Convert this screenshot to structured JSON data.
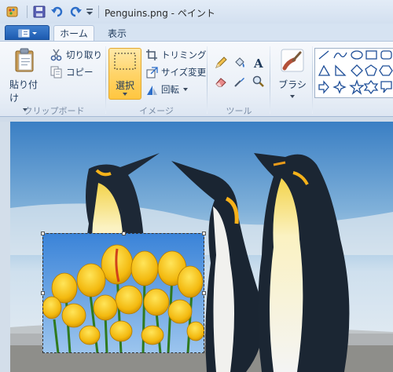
{
  "window": {
    "title": "Penguins.png - ペイント"
  },
  "qat": {
    "icons": [
      "paint-app-icon",
      "save-icon",
      "undo-icon",
      "redo-icon",
      "customize-qat-icon"
    ]
  },
  "tabs": {
    "home": "ホーム",
    "view": "表示"
  },
  "clipboard": {
    "paste": "貼り付け",
    "cut": "切り取り",
    "copy": "コピー",
    "group": "クリップボード"
  },
  "image": {
    "select": "選択",
    "crop": "トリミング",
    "resize": "サイズ変更",
    "rotate": "回転",
    "group": "イメージ"
  },
  "tools": {
    "group": "ツール",
    "items": [
      "pencil-icon",
      "fill-icon",
      "text-icon",
      "eraser-icon",
      "color-picker-icon",
      "magnifier-icon"
    ]
  },
  "brushes": {
    "label": "ブラシ"
  },
  "shapes": {
    "items": [
      "line",
      "curve",
      "oval",
      "rectangle",
      "rounded-rectangle",
      "polygon",
      "triangle",
      "right-triangle",
      "diamond",
      "pentagon",
      "hexagon",
      "right-arrow",
      "left-arrow",
      "up-arrow",
      "down-arrow",
      "four-point-star",
      "five-point-star",
      "six-point-star"
    ]
  },
  "colors": {
    "accent_blue": "#1d5bb0",
    "ribbon_bg": "#e9eff7",
    "select_active": "#ffd469",
    "canvas_bg": "#d3deea"
  }
}
